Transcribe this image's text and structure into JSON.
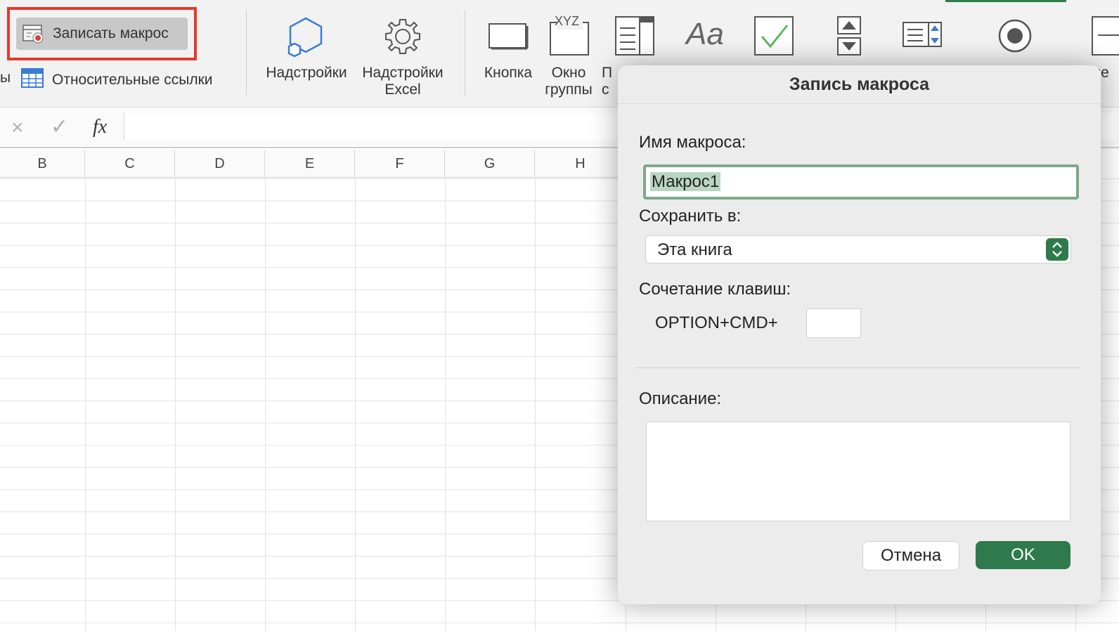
{
  "ribbon": {
    "left_cut_label": "ы",
    "record_macro": "Записать макрос",
    "relative_refs": "Относительные ссылки",
    "addins": "Надстройки",
    "excel_addins_line1": "Надстройки",
    "excel_addins_line2": "Excel",
    "button": "Кнопка",
    "groupbox_line1": "Окно",
    "groupbox_line2": "группы",
    "cut_line1": "П",
    "cut_line2": "с",
    "right_cut": "Яче",
    "groupbox_icon_text": "XYZ"
  },
  "formula_bar": {
    "cancel": "×",
    "enter": "✓",
    "fx": "fx",
    "value": ""
  },
  "columns": [
    "B",
    "C",
    "D",
    "E",
    "F",
    "G",
    "H"
  ],
  "dialog": {
    "title": "Запись макроса",
    "name_label": "Имя макроса:",
    "name_value": "Макрос1",
    "store_label": "Сохранить в:",
    "store_value": "Эта книга",
    "shortcut_label": "Сочетание клавиш:",
    "shortcut_prefix": "OPTION+CMD+",
    "shortcut_value": "",
    "description_label": "Описание:",
    "description_value": "",
    "cancel": "Отмена",
    "ok": "OK"
  },
  "colors": {
    "accent_green": "#2f7a4c",
    "highlight_red": "#e4392b",
    "ribbon_blue": "#3a7bd5"
  }
}
